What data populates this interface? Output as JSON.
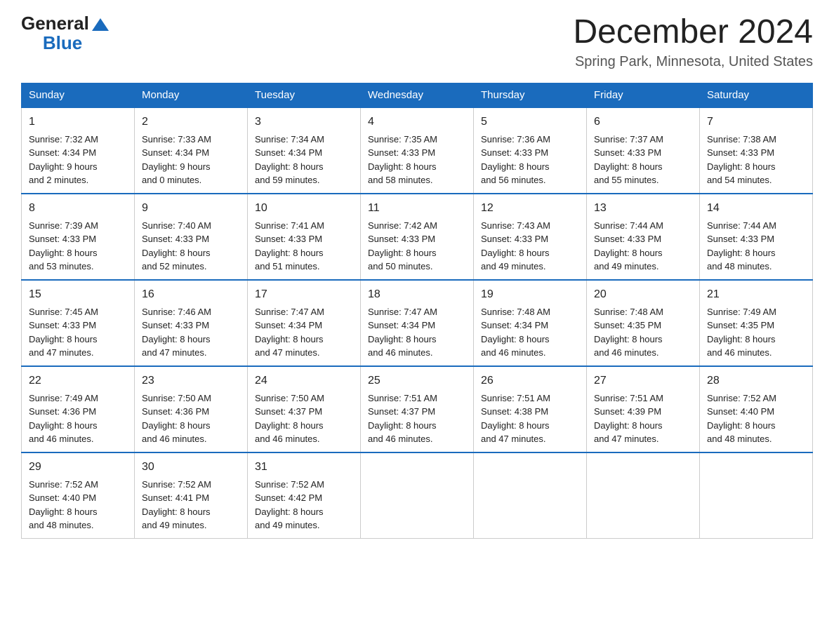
{
  "header": {
    "logo_general": "General",
    "logo_blue": "Blue",
    "month_title": "December 2024",
    "subtitle": "Spring Park, Minnesota, United States"
  },
  "days": [
    "Sunday",
    "Monday",
    "Tuesday",
    "Wednesday",
    "Thursday",
    "Friday",
    "Saturday"
  ],
  "weeks": [
    [
      {
        "day": "1",
        "sunrise": "7:32 AM",
        "sunset": "4:34 PM",
        "daylight": "9 hours and 2 minutes."
      },
      {
        "day": "2",
        "sunrise": "7:33 AM",
        "sunset": "4:34 PM",
        "daylight": "9 hours and 0 minutes."
      },
      {
        "day": "3",
        "sunrise": "7:34 AM",
        "sunset": "4:34 PM",
        "daylight": "8 hours and 59 minutes."
      },
      {
        "day": "4",
        "sunrise": "7:35 AM",
        "sunset": "4:33 PM",
        "daylight": "8 hours and 58 minutes."
      },
      {
        "day": "5",
        "sunrise": "7:36 AM",
        "sunset": "4:33 PM",
        "daylight": "8 hours and 56 minutes."
      },
      {
        "day": "6",
        "sunrise": "7:37 AM",
        "sunset": "4:33 PM",
        "daylight": "8 hours and 55 minutes."
      },
      {
        "day": "7",
        "sunrise": "7:38 AM",
        "sunset": "4:33 PM",
        "daylight": "8 hours and 54 minutes."
      }
    ],
    [
      {
        "day": "8",
        "sunrise": "7:39 AM",
        "sunset": "4:33 PM",
        "daylight": "8 hours and 53 minutes."
      },
      {
        "day": "9",
        "sunrise": "7:40 AM",
        "sunset": "4:33 PM",
        "daylight": "8 hours and 52 minutes."
      },
      {
        "day": "10",
        "sunrise": "7:41 AM",
        "sunset": "4:33 PM",
        "daylight": "8 hours and 51 minutes."
      },
      {
        "day": "11",
        "sunrise": "7:42 AM",
        "sunset": "4:33 PM",
        "daylight": "8 hours and 50 minutes."
      },
      {
        "day": "12",
        "sunrise": "7:43 AM",
        "sunset": "4:33 PM",
        "daylight": "8 hours and 49 minutes."
      },
      {
        "day": "13",
        "sunrise": "7:44 AM",
        "sunset": "4:33 PM",
        "daylight": "8 hours and 49 minutes."
      },
      {
        "day": "14",
        "sunrise": "7:44 AM",
        "sunset": "4:33 PM",
        "daylight": "8 hours and 48 minutes."
      }
    ],
    [
      {
        "day": "15",
        "sunrise": "7:45 AM",
        "sunset": "4:33 PM",
        "daylight": "8 hours and 47 minutes."
      },
      {
        "day": "16",
        "sunrise": "7:46 AM",
        "sunset": "4:33 PM",
        "daylight": "8 hours and 47 minutes."
      },
      {
        "day": "17",
        "sunrise": "7:47 AM",
        "sunset": "4:34 PM",
        "daylight": "8 hours and 47 minutes."
      },
      {
        "day": "18",
        "sunrise": "7:47 AM",
        "sunset": "4:34 PM",
        "daylight": "8 hours and 46 minutes."
      },
      {
        "day": "19",
        "sunrise": "7:48 AM",
        "sunset": "4:34 PM",
        "daylight": "8 hours and 46 minutes."
      },
      {
        "day": "20",
        "sunrise": "7:48 AM",
        "sunset": "4:35 PM",
        "daylight": "8 hours and 46 minutes."
      },
      {
        "day": "21",
        "sunrise": "7:49 AM",
        "sunset": "4:35 PM",
        "daylight": "8 hours and 46 minutes."
      }
    ],
    [
      {
        "day": "22",
        "sunrise": "7:49 AM",
        "sunset": "4:36 PM",
        "daylight": "8 hours and 46 minutes."
      },
      {
        "day": "23",
        "sunrise": "7:50 AM",
        "sunset": "4:36 PM",
        "daylight": "8 hours and 46 minutes."
      },
      {
        "day": "24",
        "sunrise": "7:50 AM",
        "sunset": "4:37 PM",
        "daylight": "8 hours and 46 minutes."
      },
      {
        "day": "25",
        "sunrise": "7:51 AM",
        "sunset": "4:37 PM",
        "daylight": "8 hours and 46 minutes."
      },
      {
        "day": "26",
        "sunrise": "7:51 AM",
        "sunset": "4:38 PM",
        "daylight": "8 hours and 47 minutes."
      },
      {
        "day": "27",
        "sunrise": "7:51 AM",
        "sunset": "4:39 PM",
        "daylight": "8 hours and 47 minutes."
      },
      {
        "day": "28",
        "sunrise": "7:52 AM",
        "sunset": "4:40 PM",
        "daylight": "8 hours and 48 minutes."
      }
    ],
    [
      {
        "day": "29",
        "sunrise": "7:52 AM",
        "sunset": "4:40 PM",
        "daylight": "8 hours and 48 minutes."
      },
      {
        "day": "30",
        "sunrise": "7:52 AM",
        "sunset": "4:41 PM",
        "daylight": "8 hours and 49 minutes."
      },
      {
        "day": "31",
        "sunrise": "7:52 AM",
        "sunset": "4:42 PM",
        "daylight": "8 hours and 49 minutes."
      },
      null,
      null,
      null,
      null
    ]
  ],
  "labels": {
    "sunrise": "Sunrise:",
    "sunset": "Sunset:",
    "daylight": "Daylight:"
  }
}
